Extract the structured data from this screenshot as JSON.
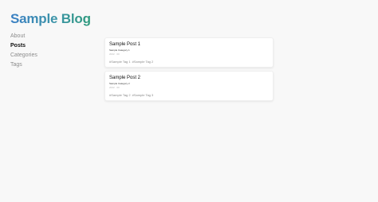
{
  "header": {
    "title": "Sample Blog",
    "title_gradient": [
      "#3a7fc4",
      "#2e9a7c"
    ]
  },
  "sidebar": {
    "items": [
      {
        "label": "About",
        "active": false
      },
      {
        "label": "Posts",
        "active": true
      },
      {
        "label": "Categories",
        "active": false
      },
      {
        "label": "Tags",
        "active": false
      }
    ]
  },
  "posts": [
    {
      "title": "Sample Post 1",
      "category": "Sample Category 1",
      "meta": "2022 · 00",
      "tags": [
        "#Sample Tag 1",
        "#Sample Tag 2"
      ]
    },
    {
      "title": "Sample Post 2",
      "category": "Sample Category 2",
      "meta": "2022 · 00",
      "tags": [
        "#Sample Tag 2",
        "#Sample Tag 3"
      ]
    }
  ]
}
